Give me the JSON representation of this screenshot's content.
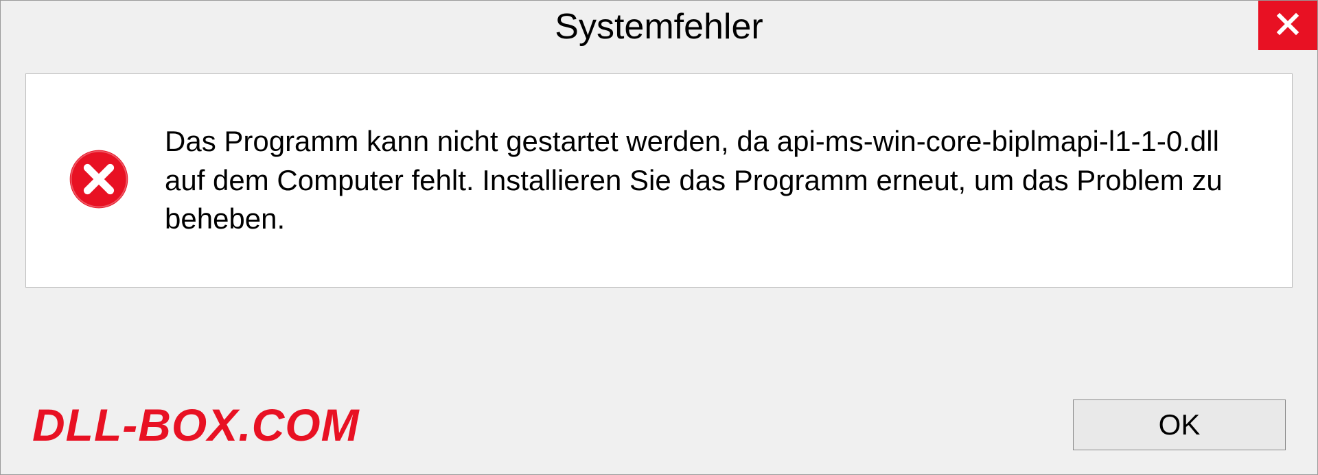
{
  "titlebar": {
    "title": "Systemfehler"
  },
  "dialog": {
    "message": "Das Programm kann nicht gestartet werden, da api-ms-win-core-biplmapi-l1-1-0.dll auf dem Computer fehlt. Installieren Sie das Programm erneut, um das Problem zu beheben."
  },
  "footer": {
    "watermark": "DLL-BOX.COM",
    "ok_label": "OK"
  },
  "colors": {
    "accent_red": "#e81123",
    "window_bg": "#f0f0f0",
    "panel_bg": "#ffffff"
  }
}
